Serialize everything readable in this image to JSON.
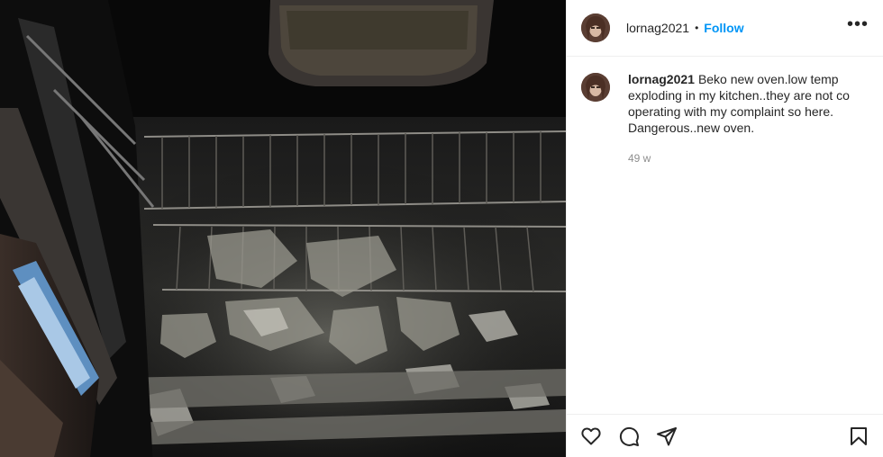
{
  "post": {
    "username": "lornag2021",
    "separator": "•",
    "follow_label": "Follow",
    "more_label": "•••",
    "caption": {
      "username": "lornag2021",
      "text": "Beko new oven.low temp exploding in my kitchen..they are not co operating with my complaint so here. Dangerous..new oven."
    },
    "timestamp": "49 w",
    "icons": {
      "like": "heart-icon",
      "comment": "comment-icon",
      "share": "paper-plane-icon",
      "save": "bookmark-icon",
      "more": "more-options-icon"
    }
  }
}
